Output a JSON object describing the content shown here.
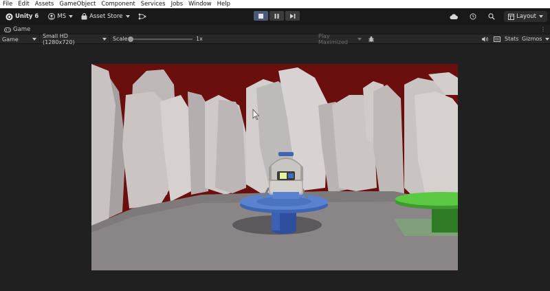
{
  "menu": [
    "File",
    "Edit",
    "Assets",
    "GameObject",
    "Component",
    "Services",
    "Jobs",
    "Window",
    "Help"
  ],
  "toolbar": {
    "app_label": "Unity 6",
    "account_label": "MS",
    "store_label": "Asset Store",
    "layout_label": "Layout"
  },
  "tab": {
    "label": "Game"
  },
  "gamebar": {
    "display_label": "Game",
    "resolution_label": "Small HD (1280x720)",
    "scale_label": "Scale",
    "scale_value": "1x",
    "play_mode_label": "Play Maximized",
    "stats_label": "Stats",
    "gizmos_label": "Gizmos"
  },
  "colors": {
    "sky": "#6a0e0e",
    "ground": "#8a8586",
    "blue_platform": "#4e78c4",
    "green_platform": "#4fb33a"
  },
  "icons": [
    "unity-logo-icon",
    "account-icon",
    "store-bag-icon",
    "version-control-icon",
    "stop-icon",
    "pause-icon",
    "step-icon",
    "cloud-icon",
    "history-icon",
    "search-icon",
    "layout-icon",
    "gamepad-icon",
    "audio-icon",
    "screen-icon",
    "bug-icon"
  ]
}
